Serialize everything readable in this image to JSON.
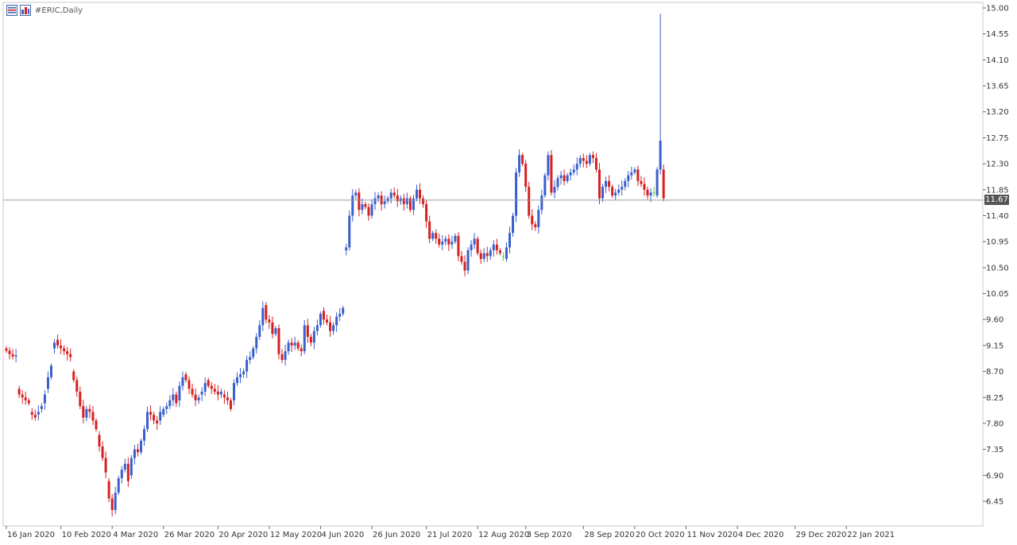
{
  "header": {
    "symbol_period": "#ERIC,Daily",
    "icons": [
      "chart-window-icon",
      "template-icon"
    ]
  },
  "current_price_label": "11.67",
  "colors": {
    "bull": "#3a5fcd",
    "bear": "#d62020",
    "doji": "#66cc33",
    "price_line": "#9a9a9a",
    "frame": "#c8c8c8"
  },
  "chart_data": {
    "type": "candlestick",
    "title": "#ERIC,Daily",
    "ylim": [
      6.0,
      15.0
    ],
    "yticks": [
      6.45,
      6.9,
      7.35,
      7.8,
      8.25,
      8.7,
      9.15,
      9.6,
      10.05,
      10.5,
      10.95,
      11.4,
      11.85,
      12.3,
      12.75,
      13.2,
      13.65,
      14.1,
      14.55,
      15.0
    ],
    "ytick_labels": [
      "6.45",
      "6.90",
      "7.35",
      "7.80",
      "8.25",
      "8.70",
      "9.15",
      "9.60",
      "10.05",
      "10.50",
      "10.95",
      "11.40",
      "11.85",
      "12.30",
      "12.75",
      "13.20",
      "13.65",
      "14.10",
      "14.55",
      "15.00"
    ],
    "xtick_labels": [
      "16 Jan 2020",
      "10 Feb 2020",
      "4 Mar 2020",
      "26 Mar 2020",
      "20 Apr 2020",
      "12 May 2020",
      "4 Jun 2020",
      "26 Jun 2020",
      "21 Jul 2020",
      "12 Aug 2020",
      "3 Sep 2020",
      "28 Sep 2020",
      "20 Oct 2020",
      "11 Nov 2020",
      "4 Dec 2020",
      "29 Dec 2020",
      "22 Jan 2021"
    ],
    "xtick_index": [
      1,
      18,
      34,
      50,
      67,
      83,
      99,
      115,
      132,
      148,
      163,
      181,
      197,
      213,
      229,
      247,
      263
    ],
    "current_price": 11.67,
    "closes": [
      9.06,
      9.0,
      8.96,
      8.98,
      8.3,
      8.25,
      8.2,
      8.15,
      7.95,
      7.9,
      8.0,
      8.1,
      8.3,
      8.6,
      8.8,
      9.2,
      9.15,
      9.1,
      9.05,
      9.0,
      8.95,
      8.55,
      8.35,
      8.1,
      7.9,
      8.05,
      8.0,
      7.85,
      7.7,
      7.4,
      7.2,
      6.95,
      6.5,
      6.3,
      6.6,
      6.85,
      7.0,
      7.1,
      6.8,
      7.2,
      7.35,
      7.3,
      7.5,
      7.7,
      8.0,
      7.95,
      7.85,
      7.8,
      8.0,
      8.05,
      8.1,
      8.2,
      8.3,
      8.15,
      8.45,
      8.6,
      8.55,
      8.4,
      8.3,
      8.2,
      8.25,
      8.35,
      8.5,
      8.45,
      8.4,
      8.35,
      8.3,
      8.35,
      8.25,
      8.2,
      8.05,
      8.5,
      8.6,
      8.65,
      8.7,
      8.9,
      8.95,
      9.1,
      9.3,
      9.5,
      9.8,
      9.6,
      9.55,
      9.35,
      9.45,
      9.0,
      8.9,
      9.05,
      9.2,
      9.15,
      9.2,
      9.1,
      9.05,
      9.5,
      9.3,
      9.2,
      9.4,
      9.5,
      9.7,
      9.6,
      9.55,
      9.4,
      9.5,
      9.65,
      9.7,
      9.8,
      10.85,
      11.4,
      11.75,
      11.8,
      11.5,
      11.6,
      11.55,
      11.4,
      11.6,
      11.7,
      11.75,
      11.6,
      11.65,
      11.7,
      11.8,
      11.75,
      11.65,
      11.7,
      11.6,
      11.7,
      11.5,
      11.7,
      11.85,
      11.7,
      11.6,
      11.3,
      11.0,
      11.1,
      11.0,
      10.9,
      10.95,
      11.0,
      10.9,
      10.95,
      11.05,
      10.7,
      10.6,
      10.45,
      10.8,
      10.9,
      11.0,
      10.75,
      10.65,
      10.75,
      10.7,
      10.8,
      10.9,
      10.8,
      10.75,
      10.7,
      10.85,
      11.1,
      11.4,
      12.15,
      12.45,
      12.3,
      11.9,
      11.4,
      11.25,
      11.2,
      11.5,
      11.75,
      12.1,
      12.45,
      11.8,
      11.9,
      12.05,
      12.1,
      12.0,
      12.1,
      12.15,
      12.2,
      12.3,
      12.4,
      12.35,
      12.3,
      12.45,
      12.4,
      12.2,
      11.7,
      11.9,
      12.0,
      11.9,
      11.75,
      11.8,
      11.85,
      11.9,
      12.0,
      12.1,
      12.15,
      12.2,
      12.0,
      11.95,
      11.85,
      11.75,
      11.8,
      11.8,
      12.2,
      12.7,
      11.7
    ],
    "opens": [
      9.1,
      9.06,
      9.0,
      8.96,
      8.4,
      8.3,
      8.25,
      8.2,
      8.0,
      7.95,
      7.95,
      8.05,
      8.15,
      8.4,
      8.6,
      9.1,
      9.25,
      9.15,
      9.1,
      9.05,
      9.0,
      8.7,
      8.55,
      8.35,
      8.1,
      7.9,
      8.05,
      8.0,
      7.85,
      7.6,
      7.4,
      7.2,
      6.8,
      6.5,
      6.3,
      6.6,
      6.85,
      7.0,
      7.1,
      6.9,
      7.2,
      7.35,
      7.3,
      7.5,
      7.7,
      8.0,
      7.95,
      7.85,
      7.85,
      7.95,
      8.05,
      8.1,
      8.2,
      8.3,
      8.2,
      8.45,
      8.65,
      8.55,
      8.4,
      8.3,
      8.2,
      8.3,
      8.35,
      8.55,
      8.45,
      8.4,
      8.35,
      8.3,
      8.3,
      8.25,
      8.2,
      8.2,
      8.5,
      8.6,
      8.65,
      8.7,
      8.9,
      8.95,
      9.1,
      9.3,
      9.5,
      9.85,
      9.6,
      9.55,
      9.35,
      9.45,
      9.0,
      8.9,
      9.05,
      9.2,
      9.15,
      9.2,
      9.1,
      9.05,
      9.5,
      9.3,
      9.2,
      9.4,
      9.5,
      9.75,
      9.6,
      9.55,
      9.4,
      9.5,
      9.65,
      9.7,
      10.8,
      10.85,
      11.4,
      11.75,
      11.8,
      11.5,
      11.6,
      11.55,
      11.4,
      11.6,
      11.7,
      11.75,
      11.6,
      11.65,
      11.7,
      11.8,
      11.75,
      11.65,
      11.7,
      11.6,
      11.7,
      11.5,
      11.7,
      11.85,
      11.7,
      11.6,
      11.3,
      11.0,
      11.1,
      11.0,
      10.9,
      10.95,
      11.0,
      10.9,
      10.95,
      11.05,
      10.7,
      10.6,
      10.45,
      10.8,
      10.9,
      11.0,
      10.75,
      10.65,
      10.75,
      10.7,
      10.8,
      10.9,
      10.8,
      10.7,
      10.65,
      10.85,
      11.1,
      11.4,
      12.15,
      12.45,
      12.3,
      11.9,
      11.4,
      11.25,
      11.2,
      11.5,
      11.75,
      12.1,
      12.45,
      11.8,
      11.9,
      12.05,
      12.1,
      12.0,
      12.1,
      12.15,
      12.2,
      12.3,
      12.4,
      12.35,
      12.3,
      12.45,
      12.4,
      12.2,
      11.7,
      11.9,
      12.0,
      11.9,
      11.75,
      11.8,
      11.85,
      11.9,
      12.0,
      12.1,
      12.15,
      12.2,
      12.0,
      11.95,
      11.85,
      11.75,
      11.8,
      11.75,
      12.2,
      12.2
    ]
  }
}
